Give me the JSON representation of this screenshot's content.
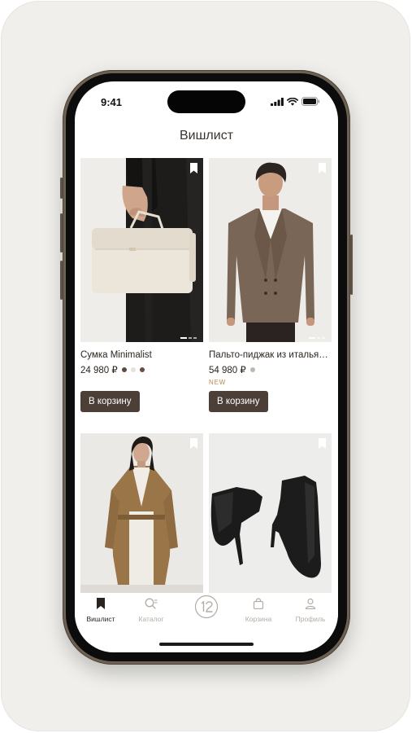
{
  "status_bar": {
    "time": "9:41"
  },
  "page": {
    "title": "Вишлист"
  },
  "products": [
    {
      "name": "Сумка Minimalist",
      "price": "24 980 ₽",
      "badge": "",
      "cart_label": "В корзину",
      "swatches": [
        "#5b4a42",
        "#e6e1da",
        "#6e4b43"
      ]
    },
    {
      "name": "Пальто-пиджак из итальянской шерсти",
      "price": "54 980 ₽",
      "badge": "NEW",
      "cart_label": "В корзину",
      "swatches": [
        "#bcb6b0"
      ]
    },
    {
      "name": "",
      "price": "",
      "badge": "",
      "cart_label": "",
      "swatches": []
    },
    {
      "name": "",
      "price": "",
      "badge": "",
      "cart_label": "",
      "swatches": []
    }
  ],
  "tabbar": {
    "items": [
      {
        "label": "Вишлист",
        "icon": "bookmark-icon",
        "active": true
      },
      {
        "label": "Каталог",
        "icon": "search-icon",
        "active": false
      },
      {
        "label": "",
        "icon": "brand-logo-icon",
        "active": false
      },
      {
        "label": "Корзина",
        "icon": "bag-icon",
        "active": false
      },
      {
        "label": "Профиль",
        "icon": "user-icon",
        "active": false
      }
    ]
  },
  "colors": {
    "accent": "#4b3f37",
    "badge_new": "#b48a52",
    "background": "#f0efeb",
    "frame": "#6c6152"
  }
}
